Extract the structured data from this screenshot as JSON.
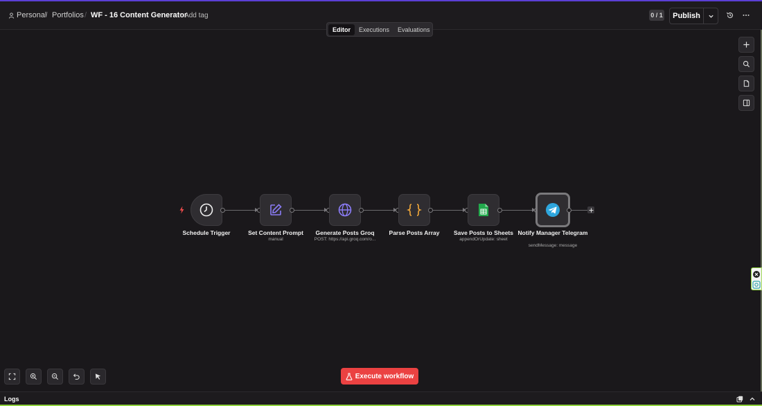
{
  "breadcrumb": {
    "personal": "Personal",
    "separator": "/",
    "portfolios": "Portfolios",
    "title": "WF - 16 Content Generator",
    "add_tag": "+ Add tag"
  },
  "header": {
    "counter": "0 / 1",
    "publish_label": "Publish",
    "icons": [
      "user-icon",
      "chevron-down-icon",
      "history-icon",
      "more-icon"
    ]
  },
  "tabs": [
    {
      "label": "Editor",
      "active": true
    },
    {
      "label": "Executions",
      "active": false
    },
    {
      "label": "Evaluations",
      "active": false
    }
  ],
  "right_toolbar": [
    "plus-icon",
    "search-icon",
    "sticky-note-icon",
    "panel-icon"
  ],
  "nodes": [
    {
      "label": "Schedule Trigger",
      "subtitle": "",
      "icon": "clock-icon"
    },
    {
      "label": "Set Content Prompt",
      "subtitle": "manual",
      "icon": "edit-icon"
    },
    {
      "label": "Generate Posts Groq",
      "subtitle": "POST: https://api.groq.com/o...",
      "icon": "globe-icon"
    },
    {
      "label": "Parse Posts Array",
      "subtitle": "",
      "icon": "code-braces-icon"
    },
    {
      "label": "Save Posts to Sheets",
      "subtitle": "appendOrUpdate: sheet",
      "icon": "google-sheets-icon"
    },
    {
      "label": "Notify Manager Telegram",
      "subtitle": "sendMessage: message",
      "icon": "telegram-icon"
    }
  ],
  "execute_label": "Execute workflow",
  "bottom_toolbar": [
    "fit-view-icon",
    "zoom-in-icon",
    "zoom-out-icon",
    "undo-icon",
    "cursor-icon"
  ],
  "logs": {
    "label": "Logs"
  },
  "colors": {
    "accent": "#eb4242",
    "top_line": "#5b3fd6",
    "edit_icon": "#8b7cf6",
    "globe_icon": "#8b7cf6",
    "braces_icon": "#f3a93a",
    "sheets_icon": "#22a94c",
    "telegram_icon": "#2ea6dd"
  }
}
